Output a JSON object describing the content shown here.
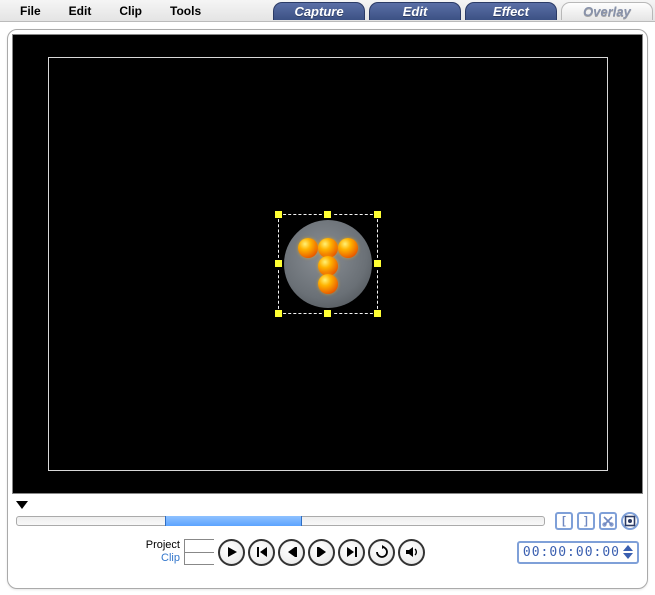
{
  "menu": {
    "file": "File",
    "edit": "Edit",
    "clip": "Clip",
    "tools": "Tools"
  },
  "tabs": {
    "capture": "Capture",
    "edit": "Edit",
    "effect": "Effect",
    "overlay": "Overlay",
    "active": "overlay"
  },
  "overlay": {
    "object_name": "overlay-graphic"
  },
  "timeline": {
    "clip_start_pct": 28,
    "clip_end_pct": 54
  },
  "labels": {
    "project": "Project",
    "clip": "Clip"
  },
  "bracket_buttons": {
    "mark_in": "[",
    "mark_out": "]"
  },
  "timecode": "00:00:00:00"
}
